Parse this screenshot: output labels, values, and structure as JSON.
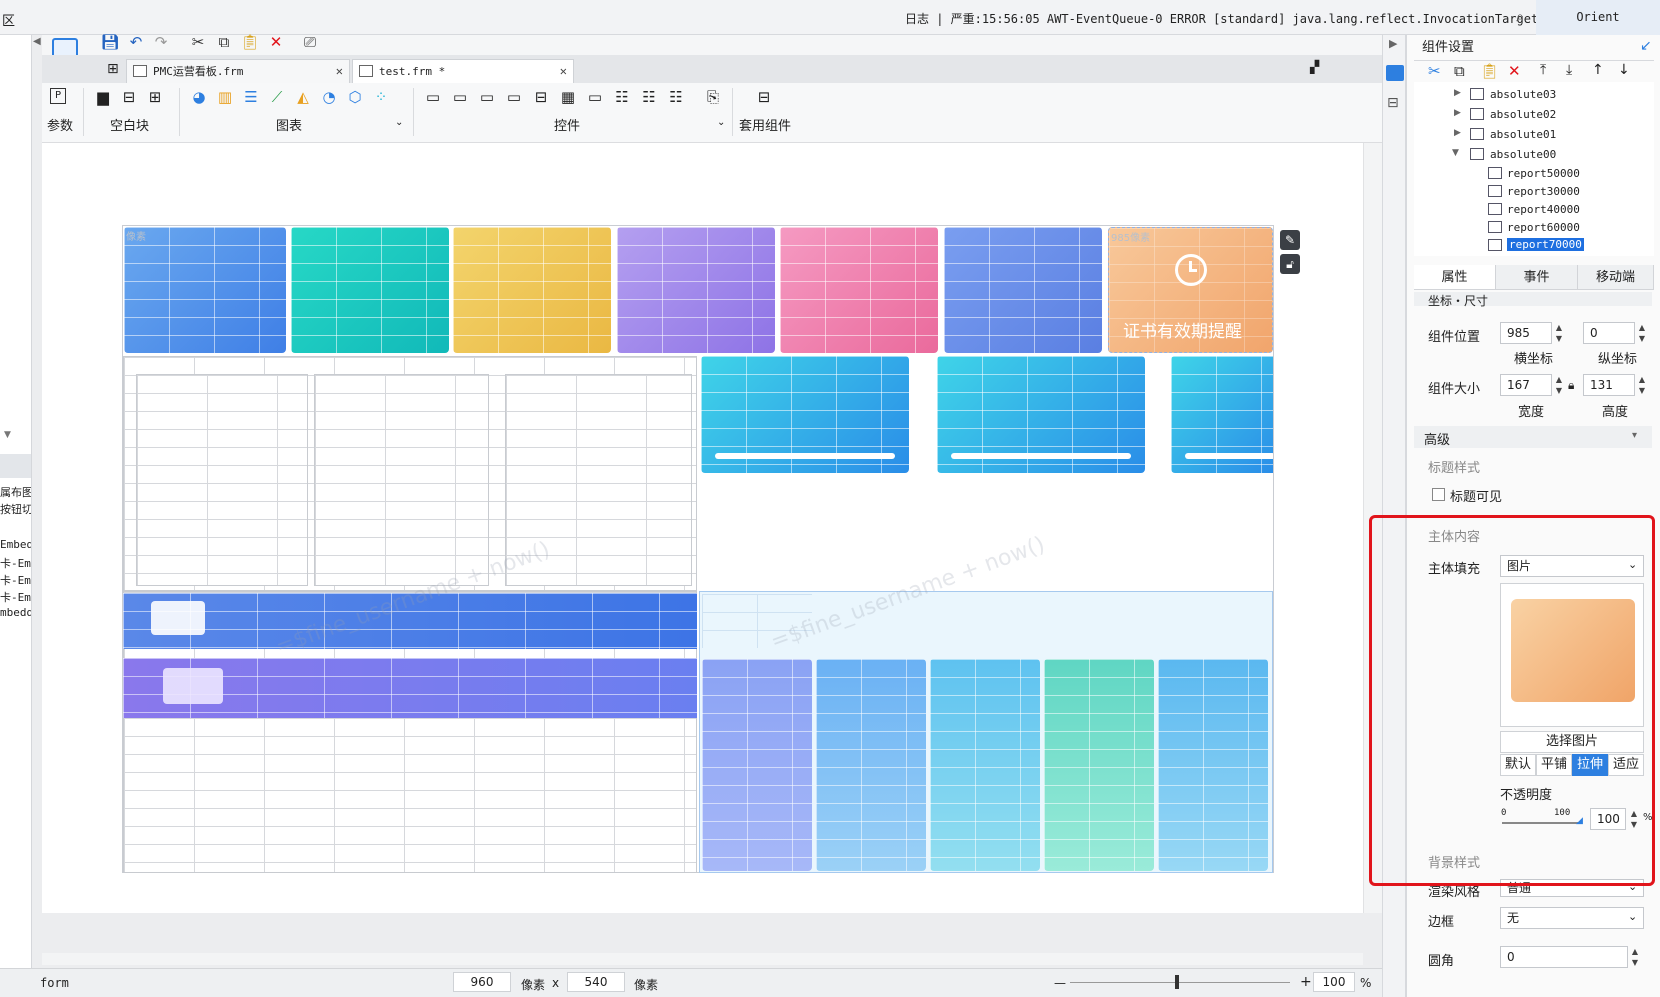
{
  "topbar": {
    "left_glyph": "区",
    "log_text": "日志 | 严重:15:56:05 AWT-EventQueue-0 ERROR [standard] java.lang.reflect.InvocationTargetException",
    "user": "Orient"
  },
  "left_panel": {
    "items": [
      "属布图",
      "按钮切",
      "Embed",
      "卡-Emb",
      "卡-Emb",
      "卡-Emb",
      "mbedde"
    ]
  },
  "tabs": [
    {
      "label": "PMC运营看板.frm"
    },
    {
      "label": "test.frm *"
    }
  ],
  "ribbon": {
    "params_label": "参数",
    "blank_label": "空白块",
    "chart_label": "图表",
    "control_label": "控件",
    "template_label": "套用组件"
  },
  "canvas": {
    "alert_title": "证书有效期提醒",
    "pixel_label_1": "像素",
    "pixel_label_2": "985像素",
    "watermark": "=$fine_username + now()"
  },
  "status": {
    "mode": "form",
    "width": "960",
    "unit1": "像素",
    "times": "x",
    "height": "540",
    "unit2": "像素",
    "zoom": "100",
    "zoom_unit": "%",
    "minus": "—",
    "plus": "+"
  },
  "panel": {
    "title": "组件设置",
    "tree": [
      {
        "label": "absolute03"
      },
      {
        "label": "absolute02"
      },
      {
        "label": "absolute01"
      },
      {
        "label": "absolute00"
      },
      {
        "label": "report50000"
      },
      {
        "label": "report30000"
      },
      {
        "label": "report40000"
      },
      {
        "label": "report60000"
      },
      {
        "label": "report70000"
      }
    ],
    "tabs": [
      "属性",
      "事件",
      "移动端"
    ],
    "section_coords": "坐标・尺寸",
    "pos_label": "组件位置",
    "x_value": "985",
    "y_value": "0",
    "x_caption": "横坐标",
    "y_caption": "纵坐标",
    "size_label": "组件大小",
    "w_value": "167",
    "h_value": "131",
    "w_caption": "宽度",
    "h_caption": "高度",
    "section_advanced": "高级",
    "title_style": "标题样式",
    "title_visible": "标题可见",
    "body_content": "主体内容",
    "body_fill_label": "主体填充",
    "body_fill_value": "图片",
    "choose_image": "选择图片",
    "fill_modes": [
      "默认",
      "平铺",
      "拉伸",
      "适应"
    ],
    "fill_mode_selected": "拉伸",
    "opacity_label": "不透明度",
    "opacity_min": "0",
    "opacity_max": "100",
    "opacity_value": "100",
    "opacity_unit": "%",
    "bg_style": "背景样式",
    "render_label": "渲染风格",
    "render_value": "普通",
    "border_label": "边框",
    "border_value": "无",
    "radius_label": "圆角",
    "radius_value": "0"
  },
  "colors": {
    "accent": "#2d7fe0",
    "highlight_red": "#e1141b",
    "selected_tree": "#1e6fe0"
  }
}
